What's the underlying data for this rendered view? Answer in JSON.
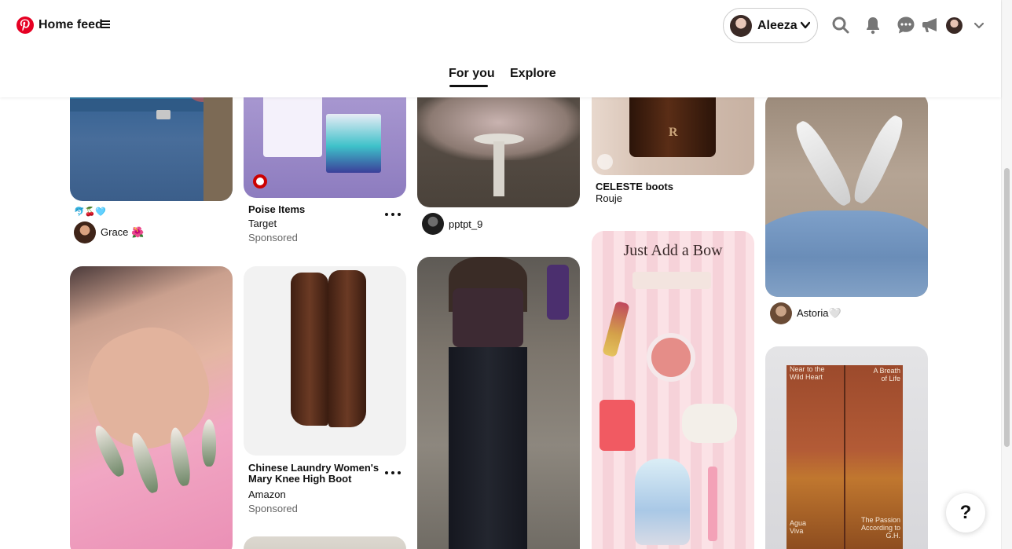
{
  "header": {
    "logo_icon": "pinterest-logo-icon",
    "home_feed_label": "Home feed",
    "profile_name": "Aleeza",
    "tabs": [
      {
        "label": "For you",
        "active": true
      },
      {
        "label": "Explore",
        "active": false
      }
    ],
    "icons": [
      "search-icon",
      "bell-icon",
      "messages-icon",
      "megaphone-icon",
      "avatar",
      "chevron-down-icon"
    ]
  },
  "pins": {
    "grace": {
      "caption": "🐬🍒🩵",
      "user": "Grace 🌺"
    },
    "poise": {
      "title": "Poise Items",
      "advertiser": "Target",
      "sponsored": "Sponsored"
    },
    "pptpt": {
      "user": "pptpt_9"
    },
    "celeste": {
      "title": "CELESTE boots",
      "brand": "Rouje"
    },
    "astoria": {
      "user": "Astoria🤍"
    },
    "boot": {
      "title_line1": "Chinese Laundry Women's",
      "title_line2": "Mary Knee High Boot",
      "advertiser": "Amazon",
      "sponsored": "Sponsored"
    },
    "bow": {
      "overlay_text": "Just Add a Bow"
    },
    "books": {
      "cover1": "Near to the Wild Heart",
      "cover2": "A Breath of Life",
      "cover3": "Agua Viva",
      "cover4": "The Passion According to G.H."
    }
  },
  "help": {
    "label": "?"
  },
  "colors": {
    "brand": "#e60023",
    "text": "#111111",
    "muted": "#666666"
  }
}
